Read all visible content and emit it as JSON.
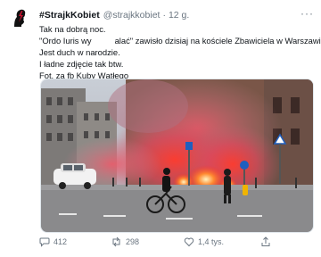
{
  "tweet": {
    "author_name": "#StrajkKobiet",
    "handle": "@strajkkobiet",
    "separator": "·",
    "time": "12 g.",
    "more_label": "···",
    "lines": [
      "Tak na dobrą noc.",
      "\"Ordo Iuris wy",
      "alać\" zawisło dzisiaj na kościele Zbawiciela w Warszawie.",
      "Jest duch w narodzie.",
      "I ładne zdjęcie tak btw.",
      "Fot. za fb Kuby Wątłego"
    ]
  },
  "actions": {
    "replies": "412",
    "retweets": "298",
    "likes": "1,4 tys."
  },
  "colors": {
    "accent": "#c8102e",
    "secondary_text": "#6a7580"
  }
}
